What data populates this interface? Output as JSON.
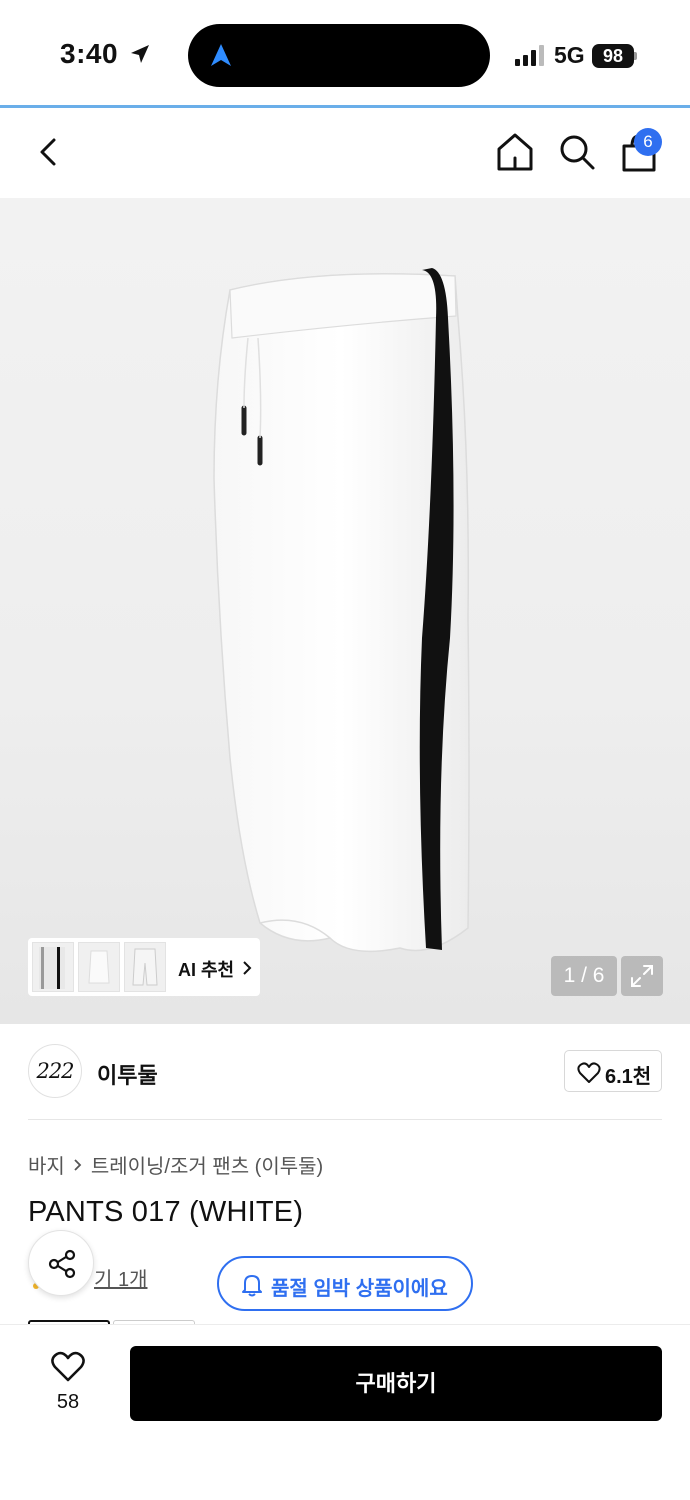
{
  "status_bar": {
    "time": "3:40",
    "network": "5G",
    "battery": "98"
  },
  "nav": {
    "cart_count": "6"
  },
  "gallery": {
    "ai_label": "AI 추천",
    "pager": "1 / 6"
  },
  "brand": {
    "logo_text": "222",
    "name": "이투둘",
    "likes": "6.1천"
  },
  "breadcrumb": {
    "category": "바지",
    "subcategory": "트레이닝/조거 팬츠 (이투둘)"
  },
  "product": {
    "title": "PANTS 017 (WHITE)",
    "review_partial": "기 1개",
    "soldout_badge": "품절 임박 상품이에요"
  },
  "bottom": {
    "wish_count": "58",
    "buy_label": "구매하기"
  },
  "colors": {
    "accent": "#2f6ff0",
    "buy_button": "#000000"
  }
}
